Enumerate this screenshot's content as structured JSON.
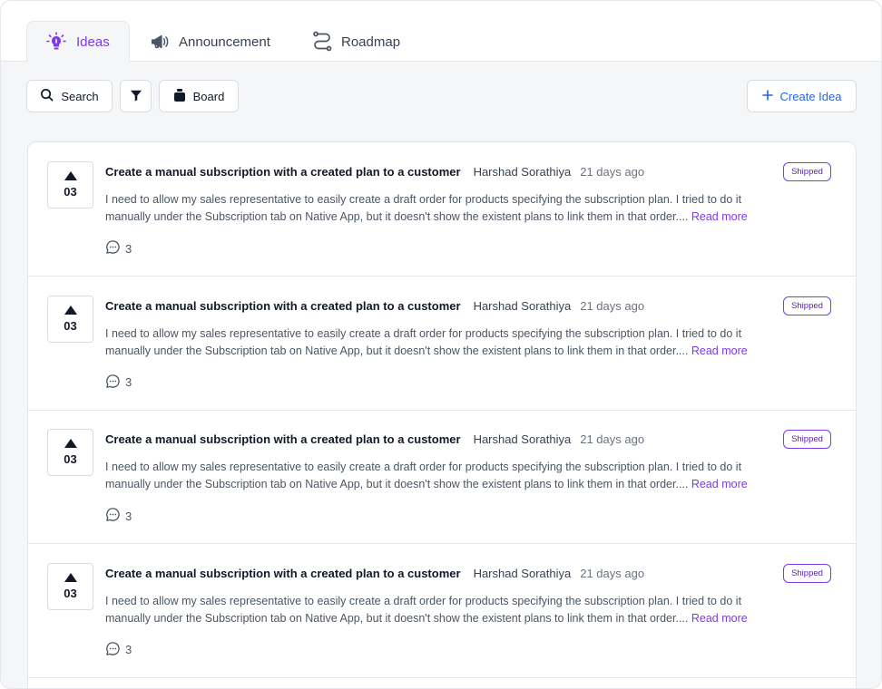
{
  "tabs": [
    {
      "label": "Ideas",
      "icon": "lightbulb-icon",
      "active": true
    },
    {
      "label": "Announcement",
      "icon": "megaphone-icon",
      "active": false
    },
    {
      "label": "Roadmap",
      "icon": "roadmap-icon",
      "active": false
    }
  ],
  "toolbar": {
    "search_label": "Search",
    "filter_icon": "filter-icon",
    "board_label": "Board",
    "create_label": "Create Idea"
  },
  "colors": {
    "accent": "#7c3aed",
    "link": "#2563eb"
  },
  "ideas": [
    {
      "votes": "03",
      "title": "Create a manual subscription with a created plan to a customer",
      "author": "Harshad Sorathiya",
      "time": "21 days ago",
      "description": "I need to allow my sales representative to easily create a draft order for products specifying the subscription plan. I tried to do it manually under the Subscription tab on Native App, but it doesn't show the existent plans to link them in that order....",
      "read_more": "Read more",
      "comments": "3",
      "status": "Shipped"
    },
    {
      "votes": "03",
      "title": "Create a manual subscription with a created plan to a customer",
      "author": "Harshad Sorathiya",
      "time": "21 days ago",
      "description": "I need to allow my sales representative to easily create a draft order for products specifying the subscription plan. I tried to do it manually under the Subscription tab on Native App, but it doesn't show the existent plans to link them in that order....",
      "read_more": "Read more",
      "comments": "3",
      "status": "Shipped"
    },
    {
      "votes": "03",
      "title": "Create a manual subscription with a created plan to a customer",
      "author": "Harshad Sorathiya",
      "time": "21 days ago",
      "description": "I need to allow my sales representative to easily create a draft order for products specifying the subscription plan. I tried to do it manually under the Subscription tab on Native App, but it doesn't show the existent plans to link them in that order....",
      "read_more": "Read more",
      "comments": "3",
      "status": "Shipped"
    },
    {
      "votes": "03",
      "title": "Create a manual subscription with a created plan to a customer",
      "author": "Harshad Sorathiya",
      "time": "21 days ago",
      "description": "I need to allow my sales representative to easily create a draft order for products specifying the subscription plan. I tried to do it manually under the Subscription tab on Native App, but it doesn't show the existent plans to link them in that order....",
      "read_more": "Read more",
      "comments": "3",
      "status": "Shipped"
    }
  ]
}
